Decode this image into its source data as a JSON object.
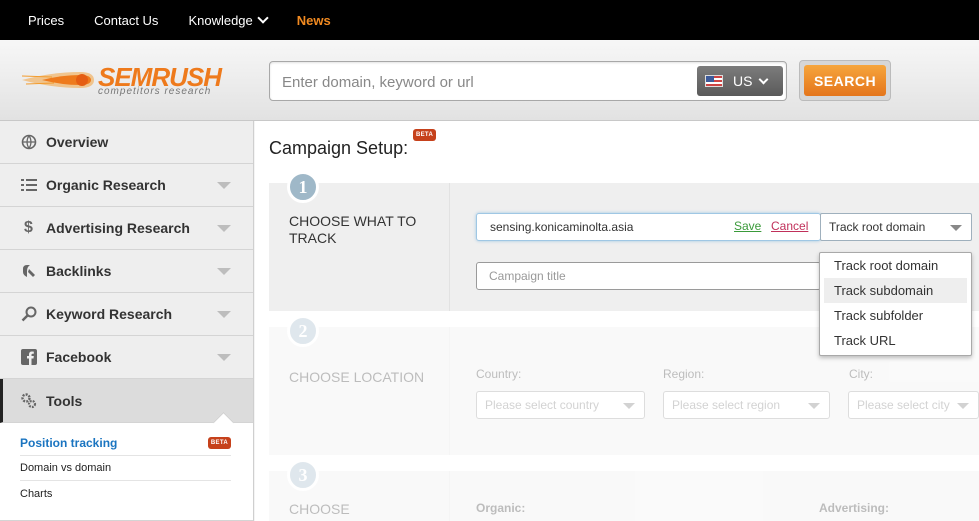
{
  "topnav": {
    "items": [
      {
        "label": "Prices"
      },
      {
        "label": "Contact Us"
      },
      {
        "label": "Knowledge"
      },
      {
        "label": "News"
      }
    ]
  },
  "header": {
    "logo_word": "SEMRUSH",
    "logo_tagline": "competitors research",
    "search_placeholder": "Enter domain, keyword or url",
    "country_code": "US",
    "search_button": "SEARCH"
  },
  "sidebar": {
    "items": [
      {
        "label": "Overview",
        "icon": "globe-icon"
      },
      {
        "label": "Organic Research",
        "icon": "list-icon"
      },
      {
        "label": "Advertising Research",
        "icon": "dollar-icon"
      },
      {
        "label": "Backlinks",
        "icon": "link-icon"
      },
      {
        "label": "Keyword Research",
        "icon": "search-icon"
      },
      {
        "label": "Facebook",
        "icon": "facebook-icon"
      },
      {
        "label": "Tools",
        "icon": "gears-icon"
      }
    ],
    "submenu": [
      {
        "label": "Position tracking",
        "badge": "BETA"
      },
      {
        "label": "Domain vs domain"
      },
      {
        "label": "Charts"
      }
    ]
  },
  "main": {
    "title": "Campaign Setup:",
    "title_badge": "BETA",
    "step1": {
      "number": "1",
      "title": "CHOOSE WHAT TO TRACK",
      "domain_value": "sensing.konicaminolta.asia",
      "save_label": "Save",
      "cancel_label": "Cancel",
      "track_selected": "Track root domain",
      "campaign_placeholder": "Campaign title"
    },
    "track_options": [
      {
        "label": "Track root domain"
      },
      {
        "label": "Track subdomain"
      },
      {
        "label": "Track subfolder"
      },
      {
        "label": "Track URL"
      }
    ],
    "step2": {
      "number": "2",
      "title": "CHOOSE LOCATION",
      "country_label": "Country:",
      "country_placeholder": "Please select country",
      "region_label": "Region:",
      "region_placeholder": "Please select region",
      "city_label": "City:",
      "city_placeholder": "Please select city"
    },
    "step3": {
      "number": "3",
      "title": "CHOOSE COMPETITORS",
      "organic_label": "Organic:",
      "advertising_label": "Advertising:"
    }
  },
  "colors": {
    "accent_orange": "#f18a21",
    "link_blue": "#1a74c0",
    "save_green": "#3a9a3a",
    "cancel_red": "#c0305a",
    "beta_badge": "#c6411b"
  }
}
